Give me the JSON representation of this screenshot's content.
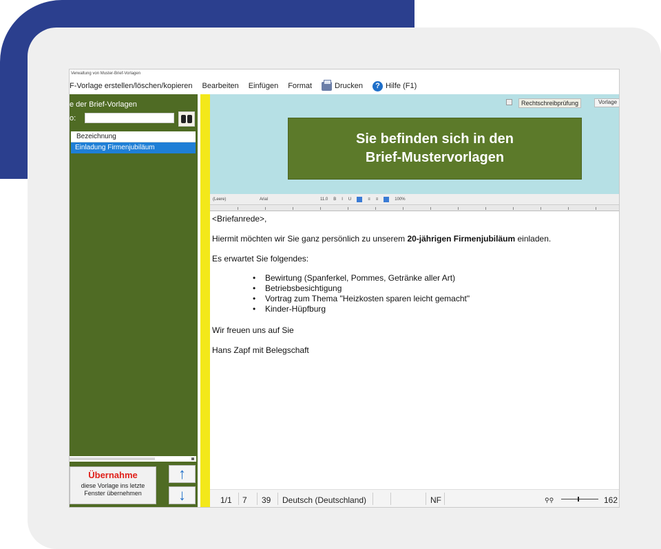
{
  "window": {
    "title": "Verwaltung von Muster-Brief-Vorlagen"
  },
  "menu": {
    "items": [
      "F-Vorlage erstellen/löschen/kopieren",
      "Bearbeiten",
      "Einfügen",
      "Format",
      "Drucken",
      "Hilfe (F1)"
    ]
  },
  "left": {
    "title": "e der Brief-Vorlagen",
    "search_label": "o:",
    "search_value": "",
    "list_header": "Bezeichnung",
    "list_items": [
      "Einladung Firmenjubiläum"
    ],
    "apply_title": "Übernahme",
    "apply_text_1": "diese Vorlage ins letzte",
    "apply_text_2": "Fenster übernehmen",
    "up_arrow": "↑",
    "down_arrow": "↓"
  },
  "right": {
    "spellcheck_label": "Rechtschreibprüfung",
    "btn_label": "Vorlage",
    "banner_line1": "Sie befinden sich in den",
    "banner_line2": "Brief-Mustervorlagen",
    "toolbar": {
      "style": "(Leere)",
      "font": "Arial",
      "size": "11.0",
      "zoom": "100%"
    }
  },
  "document": {
    "salutation": "<Briefanrede>,",
    "intro_pre": "Hiermit möchten wir Sie ganz persönlich zu unserem ",
    "intro_bold": "20-jährigen Firmenjubiläum",
    "intro_post": " einladen.",
    "expect": "Es erwartet Sie folgendes:",
    "bullets": [
      "Bewirtung (Spanferkel, Pommes, Getränke aller Art)",
      "Betriebsbesichtigung",
      "Vortrag zum Thema \"Heizkosten sparen leicht gemacht\"",
      "Kinder-Hüpfburg"
    ],
    "closing": "Wir freuen uns auf Sie",
    "signature": "Hans Zapf mit Belegschaft"
  },
  "status": {
    "page": "1/1",
    "words": "7",
    "chars": "39",
    "language": "Deutsch (Deutschland)",
    "mode": "NF",
    "zoom_icons": "⚲⚲",
    "zoom_value": "162"
  },
  "colors": {
    "brand_blue": "#2b3f8e",
    "panel_green": "#4f6b24",
    "banner_green": "#5c7a2a",
    "accent_yellow": "#f3e81a",
    "selection_blue": "#1e7fd6",
    "banner_bg": "#b6e0e5"
  }
}
